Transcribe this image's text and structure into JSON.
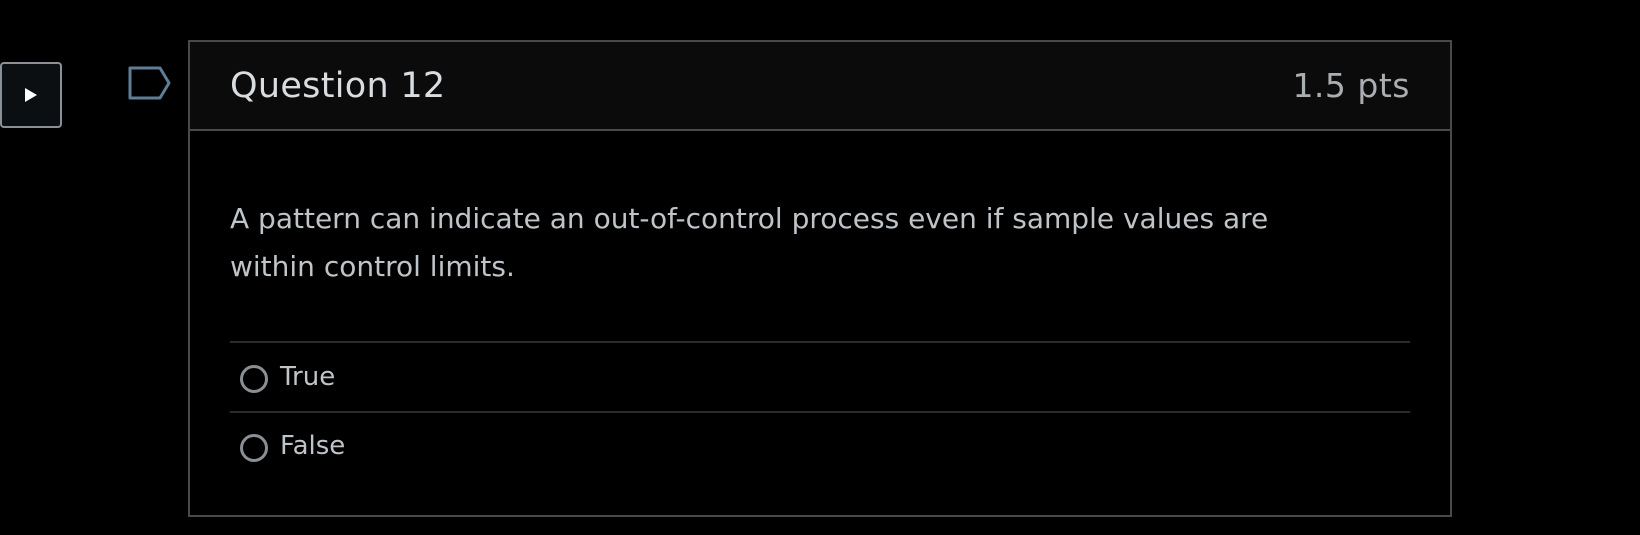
{
  "controls": {
    "play_icon": "play-triangle-icon",
    "flag_icon": "flag-icon"
  },
  "question": {
    "title": "Question 12",
    "points": "1.5 pts",
    "text": "A pattern can indicate an out-of-control process even if sample values are within control limits.",
    "answers": [
      {
        "label": "True",
        "selected": false
      },
      {
        "label": "False",
        "selected": false
      }
    ]
  },
  "colors": {
    "background": "#000000",
    "header_background": "#0b0b0b",
    "border": "#4a4a4a",
    "text": "#bfc4c8",
    "title": "#d9dde1"
  }
}
